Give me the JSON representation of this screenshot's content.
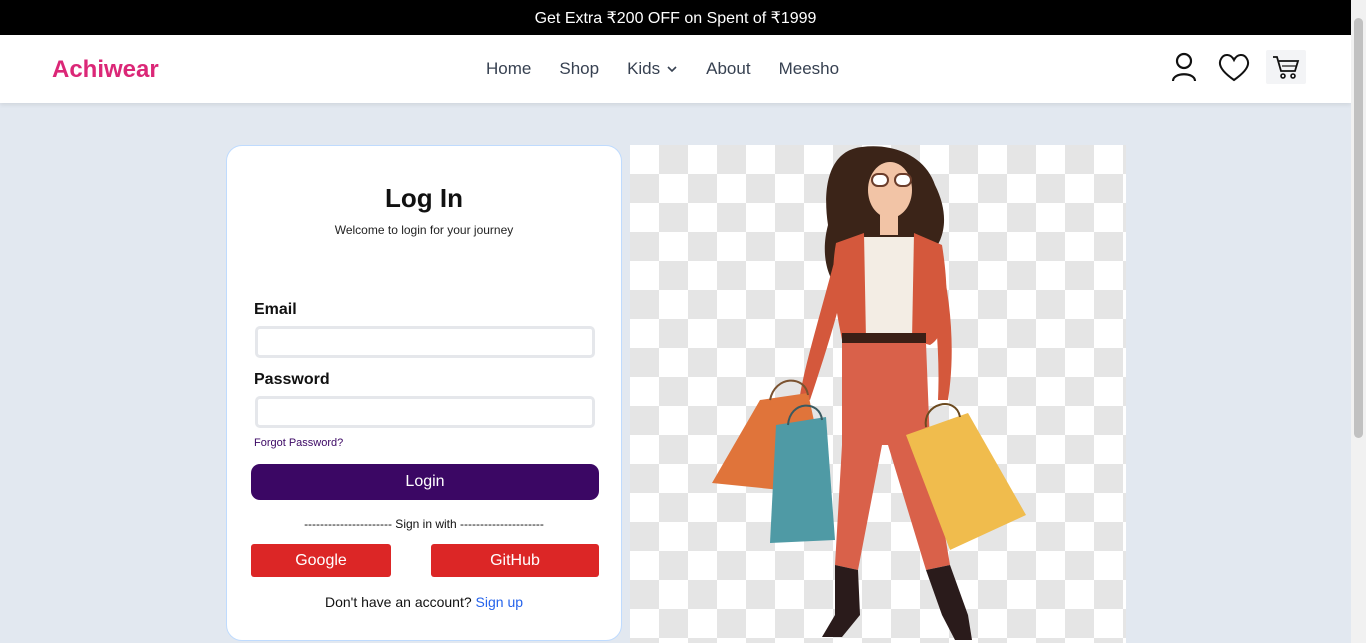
{
  "announcement": "Get Extra ₹200 OFF on Spent of ₹1999",
  "brand": {
    "name": "Achiwear",
    "color": "#db2777"
  },
  "nav": {
    "links": [
      "Home",
      "Shop",
      "Kids",
      "About",
      "Meesho"
    ],
    "icons": [
      "user-icon",
      "heart-icon",
      "cart-icon"
    ]
  },
  "login": {
    "title": "Log In",
    "subtitle": "Welcome to login for your journey",
    "email_label": "Email",
    "email_value": "",
    "password_label": "Password",
    "password_value": "",
    "forgot": "Forgot Password?",
    "submit": "Login",
    "divider": "---------------------- Sign in with ---------------------",
    "google": "Google",
    "github": "GitHub",
    "no_account": "Don't have an account?",
    "signup": "Sign up"
  },
  "colors": {
    "primary": "#3b0764",
    "social": "#dc2626",
    "link": "#2563eb",
    "background": "#e2e8f0"
  }
}
